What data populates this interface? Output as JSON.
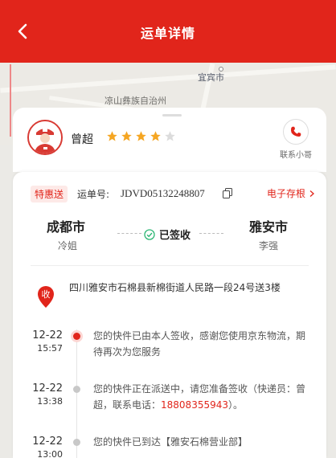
{
  "header": {
    "title": "运单详情"
  },
  "map": {
    "labels": [
      "宜宾市",
      "凉山彝族自治州"
    ]
  },
  "courier": {
    "name": "曾超",
    "rating": 4,
    "max_rating": 5,
    "contact_label": "联系小哥"
  },
  "waybill": {
    "tag": "特惠送",
    "number_label": "运单号:",
    "number": "JDVD05132248807",
    "estore_label": "电子存根",
    "origin_city": "成都市",
    "sender": "冷姐",
    "status": "已签收",
    "dest_city": "雅安市",
    "receiver": "李强",
    "address": "四川雅安市石棉县新棉街道人民路一段24号送3楼",
    "address_badge": "收"
  },
  "timeline": [
    {
      "date": "12-22",
      "time": "15:57",
      "text": "您的快件已由本人签收，感谢您使用京东物流，期待再次为您服务"
    },
    {
      "date": "12-22",
      "time": "13:38",
      "text_before": "您的快件正在派送中，请您准备签收（快递员：曾超，联系电话：",
      "phone": "18808355943",
      "text_after": "）。"
    },
    {
      "date": "12-22",
      "time": "13:00",
      "text": "您的快件已到达【雅安石棉营业部】"
    }
  ],
  "colors": {
    "brand": "#e1251b",
    "star": "#f5a623"
  }
}
